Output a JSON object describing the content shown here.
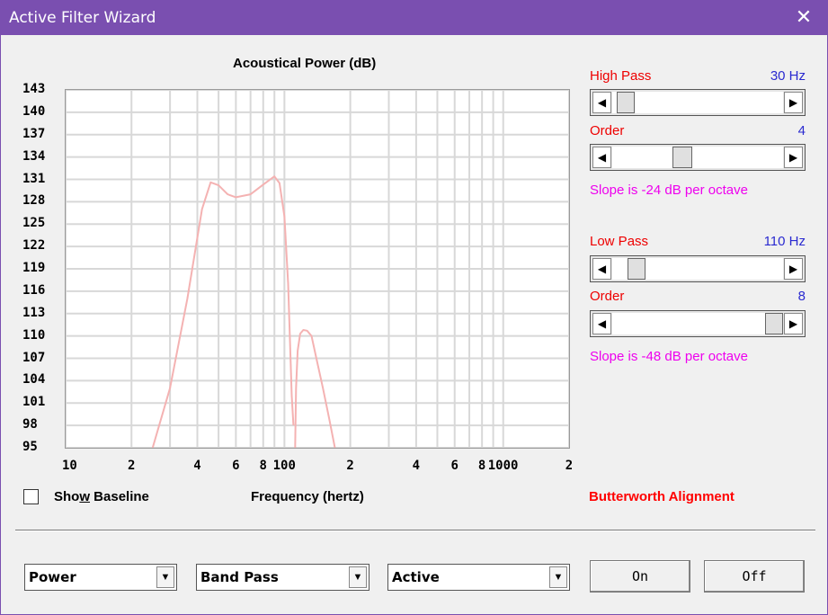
{
  "window": {
    "title": "Active Filter Wizard",
    "close_icon": "close-icon"
  },
  "chart_data": {
    "type": "line",
    "title": "Acoustical Power (dB)",
    "xlabel": "Frequency (hertz)",
    "ylabel": "",
    "xscale": "log",
    "xlim": [
      10,
      2000
    ],
    "ylim": [
      95,
      143
    ],
    "y_ticks": [
      "143",
      "140",
      "137",
      "134",
      "131",
      "128",
      "125",
      "122",
      "119",
      "116",
      "113",
      "110",
      "107",
      "104",
      "101",
      "98",
      "95"
    ],
    "x_ticks": [
      "10",
      "2",
      "4",
      "6",
      "8",
      "100",
      "2",
      "4",
      "6",
      "8",
      "1000",
      "2"
    ],
    "series": [
      {
        "color": "#f4b2b2",
        "x": [
          25,
          30,
          36,
          42,
          46,
          50,
          55,
          60,
          70,
          80,
          90,
          95,
          100,
          104,
          108,
          110
        ],
        "y": [
          95,
          103,
          115,
          127,
          130.6,
          130.2,
          129,
          128.6,
          129,
          130.3,
          131.4,
          130.5,
          126,
          117,
          102,
          98
        ]
      },
      {
        "color": "#f4b2b2",
        "x": [
          112,
          113,
          115,
          118,
          122,
          127,
          133,
          140,
          150,
          160,
          170
        ],
        "y": [
          95,
          103,
          108,
          110.3,
          110.8,
          110.7,
          110,
          107,
          103,
          99,
          95
        ]
      }
    ],
    "grid": true
  },
  "left_controls": {
    "show_baseline_label": "Show Baseline",
    "show_baseline_checked": false,
    "alignment_text": "Butterworth Alignment"
  },
  "high_pass": {
    "label": "High Pass",
    "value": "30 Hz",
    "order_label": "Order",
    "order_value": "4",
    "slope_text": "Slope is -24 dB per octave",
    "freq_level": 0.03,
    "order_level": 0.4
  },
  "low_pass": {
    "label": "Low Pass",
    "value": "110 Hz",
    "order_label": "Order",
    "order_value": "8",
    "slope_text": "Slope is -48 dB per octave",
    "freq_level": 0.1,
    "order_level": 1.0
  },
  "bottom": {
    "combo1": "Power",
    "combo2": "Band Pass",
    "combo3": "Active",
    "on_label": "On",
    "off_label": "Off"
  }
}
